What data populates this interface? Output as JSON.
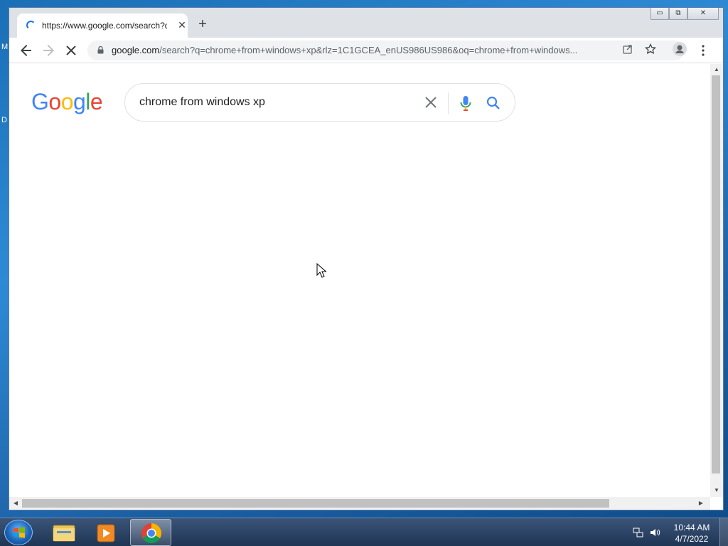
{
  "desktop": {
    "edge_chars": [
      "M",
      "D"
    ]
  },
  "browser": {
    "tab": {
      "title": "https://www.google.com/search?q=chrome+from+windows+xp",
      "close_glyph": "✕"
    },
    "new_tab_glyph": "+",
    "window_controls": {
      "minimize": "▭",
      "restore": "⧉",
      "close": "✕"
    },
    "address": {
      "host": "google.com",
      "path": "/search?q=chrome+from+windows+xp&rlz=1C1GCEA_enUS986US986&oq=chrome+from+windows..."
    },
    "toolbar_icons": [
      "back-icon",
      "forward-icon",
      "stop-icon",
      "lock-icon",
      "share-icon",
      "star-icon",
      "profile-icon",
      "menu-icon"
    ]
  },
  "page": {
    "logo_letters": [
      {
        "ch": "G",
        "color": "#4285F4"
      },
      {
        "ch": "o",
        "color": "#EA4335"
      },
      {
        "ch": "o",
        "color": "#FBBC05"
      },
      {
        "ch": "g",
        "color": "#4285F4"
      },
      {
        "ch": "l",
        "color": "#34A853"
      },
      {
        "ch": "e",
        "color": "#EA4335"
      }
    ],
    "search": {
      "value": "chrome from windows xp"
    }
  },
  "taskbar": {
    "items": [
      "start-button",
      "explorer",
      "media-player",
      "chrome"
    ],
    "clock": {
      "time": "10:44 AM",
      "date": "4/7/2022"
    }
  }
}
